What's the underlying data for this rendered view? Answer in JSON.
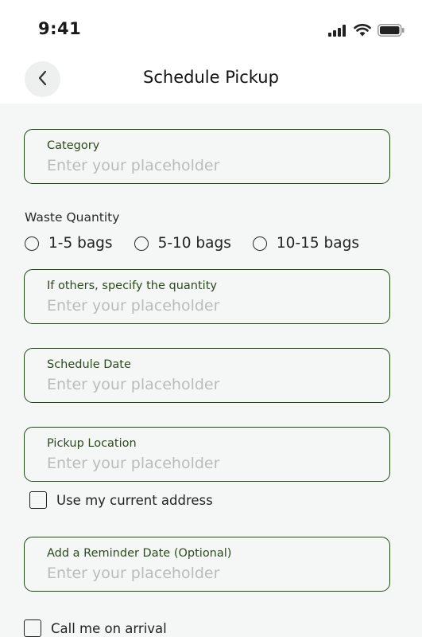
{
  "status": {
    "time": "9:41",
    "icons": [
      "signal-icon",
      "wifi-icon",
      "battery-icon"
    ]
  },
  "header": {
    "title": "Schedule Pickup",
    "back_icon": "chevron-left-icon"
  },
  "form": {
    "category": {
      "label": "Category",
      "placeholder": "Enter your placeholder",
      "value": ""
    },
    "waste_quantity": {
      "label": "Waste Quantity",
      "options": [
        "1-5 bags",
        "5-10 bags",
        "10-15 bags"
      ],
      "selected": null
    },
    "other_quantity": {
      "label": "If others, specify the  quantity",
      "placeholder": "Enter your placeholder",
      "value": ""
    },
    "schedule_date": {
      "label": "Schedule Date",
      "placeholder": "Enter your placeholder",
      "value": ""
    },
    "pickup_location": {
      "label": "Pickup Location",
      "placeholder": "Enter your placeholder",
      "value": ""
    },
    "use_current_address": {
      "label": "Use my current address",
      "checked": false
    },
    "reminder_date": {
      "label": "Add a Reminder Date (Optional)",
      "placeholder": "Enter your placeholder",
      "value": ""
    },
    "call_on_arrival": {
      "label": "Call me on arrival",
      "checked": false
    }
  },
  "colors": {
    "field_border": "#1f4a12",
    "label_text": "#2a4a1a",
    "placeholder": "#b9bcbb",
    "background": "#f5f7f6"
  }
}
